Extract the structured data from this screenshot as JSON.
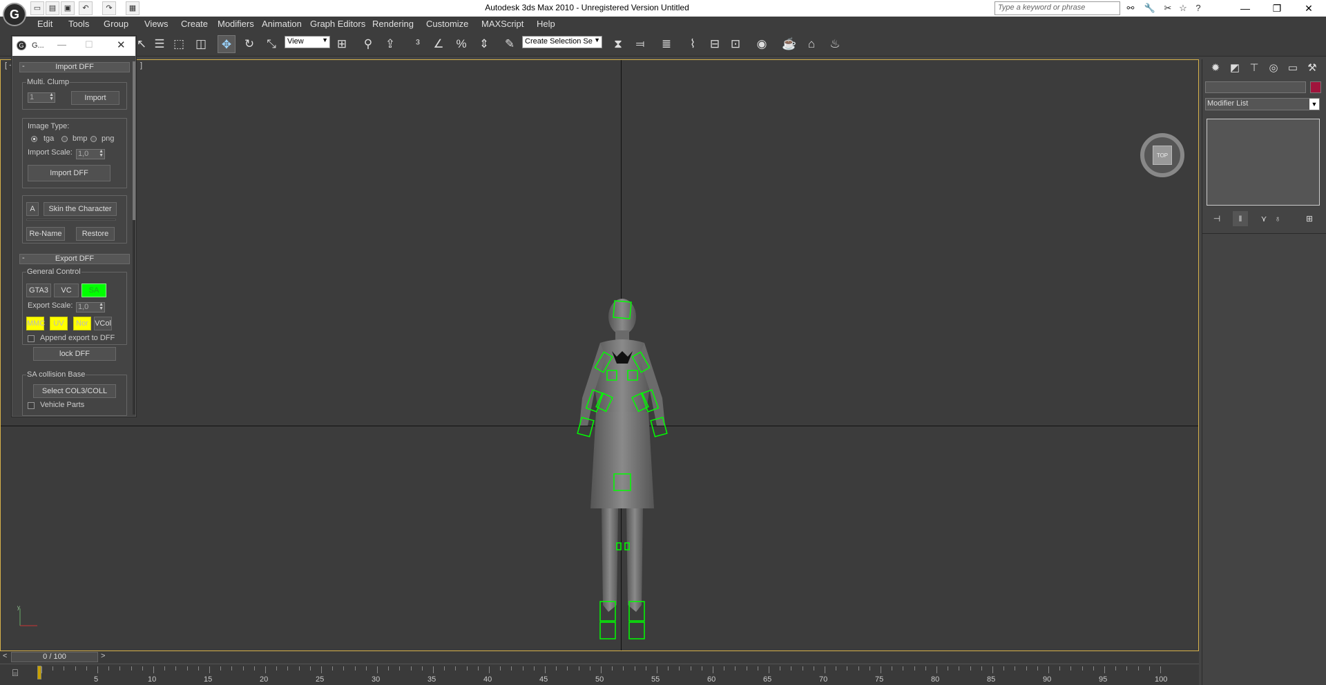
{
  "app": {
    "title": "Autodesk 3ds Max  2010  - Unregistered Version     Untitled",
    "logo_text": "G",
    "search_placeholder": "Type a keyword or phrase"
  },
  "menu": [
    "Edit",
    "Tools",
    "Group",
    "Views",
    "Create",
    "Modifiers",
    "Animation",
    "Graph Editors",
    "Rendering",
    "Customize",
    "MAXScript",
    "Help"
  ],
  "toolbar": {
    "view_combo": "View",
    "selection_set": "Create Selection Se",
    "icons": [
      "select-icon",
      "select-by-name-icon",
      "rect-region-icon",
      "window-crossing-icon",
      "move-icon",
      "rotate-icon",
      "scale-icon",
      "pivot-icon",
      "link-icon",
      "snap-icon",
      "angle-snap-icon",
      "percent-snap-icon",
      "spinner-snap-icon",
      "edit-named-sel-icon",
      "mirror-icon",
      "align-icon",
      "layer-icon",
      "curve-editor-icon",
      "schematic-icon",
      "material-editor-icon",
      "render-setup-icon",
      "rendered-frame-icon",
      "render-icon"
    ]
  },
  "viewport": {
    "label_left": "[ +",
    "label_right": "]",
    "viewcube_face": "TOP"
  },
  "floater": {
    "title": "G...",
    "import_section": "Import DFF",
    "multi_clump_label": "Multi. Clump",
    "clump_value": "1",
    "import_button": "Import",
    "image_type_label": "Image Type:",
    "image_types": [
      "tga",
      "bmp",
      "png"
    ],
    "import_scale_label": "Import Scale:",
    "import_scale_value": "1,0",
    "import_dff_button": "Import DFF",
    "a_button": "A",
    "skin_button": "Skin the Character",
    "rename_button": "Re-Name",
    "restore_button": "Restore",
    "export_section": "Export DFF",
    "general_control_label": "General Control",
    "gta3_button": "GTA3",
    "vc_button": "VC",
    "sa_button": "SA",
    "export_scale_label": "Export Scale:",
    "export_scale_value": "1,0",
    "mmc_button": "MMC",
    "uv_button": "UV",
    "nor_button": "Nor",
    "vcol_button": "VCol",
    "append_label": "Append export to DFF",
    "lock_button": "lock DFF",
    "sa_collision_label": "SA collision Base",
    "select_col_button": "Select COL3/COLL",
    "vehicle_parts_label": "Vehicle Parts"
  },
  "command_panel": {
    "modifier_list": "Modifier List",
    "color_swatch": "#a0143c"
  },
  "timeline": {
    "frame_counter": "0 / 100",
    "ticks": [
      "5",
      "10",
      "15",
      "20",
      "25",
      "30",
      "35",
      "40",
      "45",
      "50",
      "55",
      "60",
      "65",
      "70",
      "75",
      "80",
      "85",
      "90",
      "95",
      "100"
    ]
  }
}
